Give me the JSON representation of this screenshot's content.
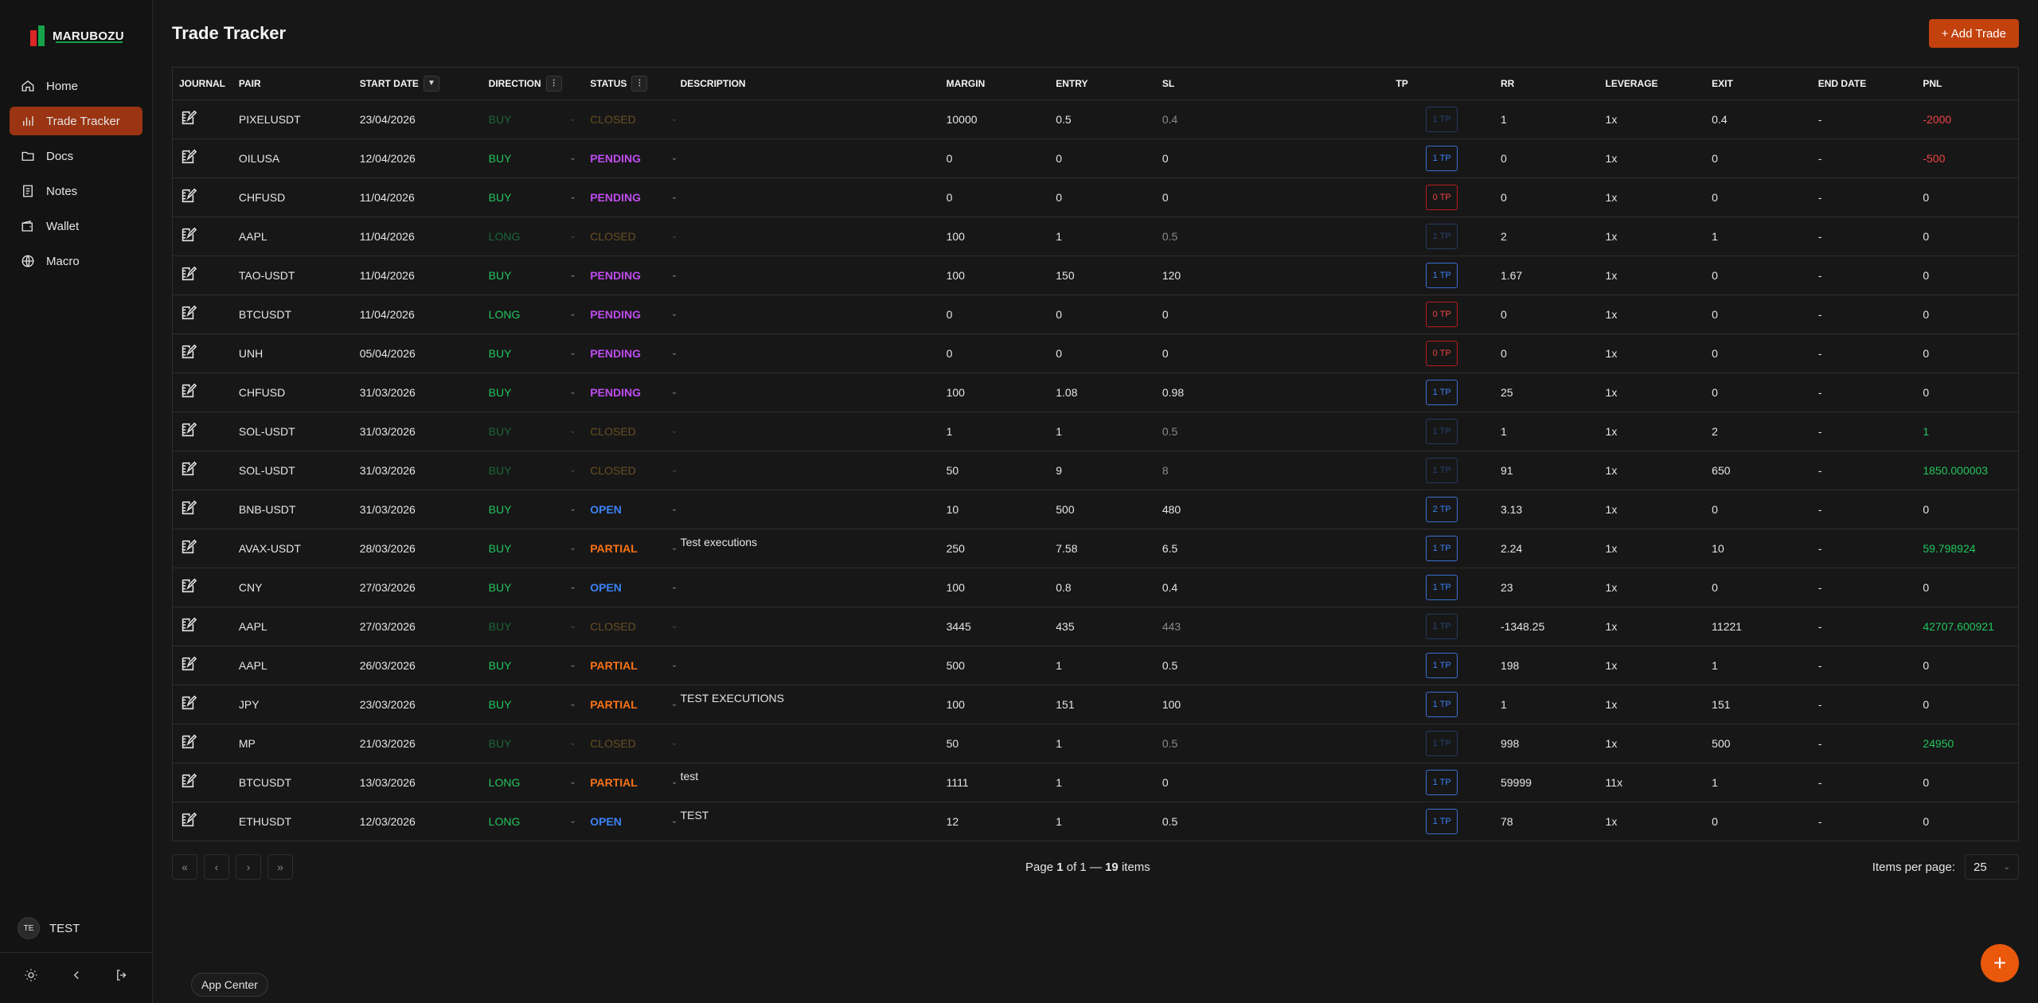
{
  "brand": {
    "name": "MARUBOZU"
  },
  "nav": [
    {
      "label": "Home",
      "icon": "home-icon",
      "active": false
    },
    {
      "label": "Trade Tracker",
      "icon": "chart-icon",
      "active": true
    },
    {
      "label": "Docs",
      "icon": "folder-icon",
      "active": false
    },
    {
      "label": "Notes",
      "icon": "notes-icon",
      "active": false
    },
    {
      "label": "Wallet",
      "icon": "wallet-icon",
      "active": false
    },
    {
      "label": "Macro",
      "icon": "globe-icon",
      "active": false
    }
  ],
  "user": {
    "initials": "TE",
    "name": "TEST"
  },
  "page": {
    "title": "Trade Tracker",
    "add_button": "+ Add Trade"
  },
  "columns": {
    "journal": "JOURNAL",
    "pair": "PAIR",
    "start_date": "START DATE",
    "direction": "DIRECTION",
    "status": "STATUS",
    "description": "DESCRIPTION",
    "margin": "MARGIN",
    "entry": "ENTRY",
    "sl": "SL",
    "tp": "TP",
    "rr": "RR",
    "leverage": "LEVERAGE",
    "exit": "EXIT",
    "end_date": "END DATE",
    "pnl": "PNL"
  },
  "rows": [
    {
      "pair": "PIXELUSDT",
      "date": "23/04/2026",
      "dir": "BUY",
      "status": "CLOSED",
      "desc": "",
      "margin": "10000",
      "entry": "0.5",
      "sl": "0.4",
      "tp": "1 TP",
      "rr": "1",
      "lev": "1x",
      "exit": "0.4",
      "end": "-",
      "pnl": "-2000",
      "pnl_class": "neg"
    },
    {
      "pair": "OILUSA",
      "date": "12/04/2026",
      "dir": "BUY",
      "status": "PENDING",
      "desc": "",
      "margin": "0",
      "entry": "0",
      "sl": "0",
      "tp": "1 TP",
      "rr": "0",
      "lev": "1x",
      "exit": "0",
      "end": "-",
      "pnl": "-500",
      "pnl_class": "neg"
    },
    {
      "pair": "CHFUSD",
      "date": "11/04/2026",
      "dir": "BUY",
      "status": "PENDING",
      "desc": "",
      "margin": "0",
      "entry": "0",
      "sl": "0",
      "tp": "0 TP",
      "rr": "0",
      "lev": "1x",
      "exit": "0",
      "end": "-",
      "pnl": "0",
      "pnl_class": ""
    },
    {
      "pair": "AAPL",
      "date": "11/04/2026",
      "dir": "LONG",
      "status": "CLOSED",
      "desc": "",
      "margin": "100",
      "entry": "1",
      "sl": "0.5",
      "tp": "1 TP",
      "rr": "2",
      "lev": "1x",
      "exit": "1",
      "end": "-",
      "pnl": "0",
      "pnl_class": ""
    },
    {
      "pair": "TAO-USDT",
      "date": "11/04/2026",
      "dir": "BUY",
      "status": "PENDING",
      "desc": "",
      "margin": "100",
      "entry": "150",
      "sl": "120",
      "tp": "1 TP",
      "rr": "1.67",
      "lev": "1x",
      "exit": "0",
      "end": "-",
      "pnl": "0",
      "pnl_class": ""
    },
    {
      "pair": "BTCUSDT",
      "date": "11/04/2026",
      "dir": "LONG",
      "status": "PENDING",
      "desc": "",
      "margin": "0",
      "entry": "0",
      "sl": "0",
      "tp": "0 TP",
      "rr": "0",
      "lev": "1x",
      "exit": "0",
      "end": "-",
      "pnl": "0",
      "pnl_class": ""
    },
    {
      "pair": "UNH",
      "date": "05/04/2026",
      "dir": "BUY",
      "status": "PENDING",
      "desc": "",
      "margin": "0",
      "entry": "0",
      "sl": "0",
      "tp": "0 TP",
      "rr": "0",
      "lev": "1x",
      "exit": "0",
      "end": "-",
      "pnl": "0",
      "pnl_class": ""
    },
    {
      "pair": "CHFUSD",
      "date": "31/03/2026",
      "dir": "BUY",
      "status": "PENDING",
      "desc": "",
      "margin": "100",
      "entry": "1.08",
      "sl": "0.98",
      "tp": "1 TP",
      "rr": "25",
      "lev": "1x",
      "exit": "0",
      "end": "-",
      "pnl": "0",
      "pnl_class": ""
    },
    {
      "pair": "SOL-USDT",
      "date": "31/03/2026",
      "dir": "BUY",
      "status": "CLOSED",
      "desc": "",
      "margin": "1",
      "entry": "1",
      "sl": "0.5",
      "tp": "1 TP",
      "rr": "1",
      "lev": "1x",
      "exit": "2",
      "end": "-",
      "pnl": "1",
      "pnl_class": "pos"
    },
    {
      "pair": "SOL-USDT",
      "date": "31/03/2026",
      "dir": "BUY",
      "status": "CLOSED",
      "desc": "",
      "margin": "50",
      "entry": "9",
      "sl": "8",
      "tp": "1 TP",
      "rr": "91",
      "lev": "1x",
      "exit": "650",
      "end": "-",
      "pnl": "1850.000003",
      "pnl_class": "pos"
    },
    {
      "pair": "BNB-USDT",
      "date": "31/03/2026",
      "dir": "BUY",
      "status": "OPEN",
      "desc": "",
      "margin": "10",
      "entry": "500",
      "sl": "480",
      "tp": "2 TP",
      "rr": "3.13",
      "lev": "1x",
      "exit": "0",
      "end": "-",
      "pnl": "0",
      "pnl_class": ""
    },
    {
      "pair": "AVAX-USDT",
      "date": "28/03/2026",
      "dir": "BUY",
      "status": "PARTIAL",
      "desc": "Test executions",
      "margin": "250",
      "entry": "7.58",
      "sl": "6.5",
      "tp": "1 TP",
      "rr": "2.24",
      "lev": "1x",
      "exit": "10",
      "end": "-",
      "pnl": "59.798924",
      "pnl_class": "pos"
    },
    {
      "pair": "CNY",
      "date": "27/03/2026",
      "dir": "BUY",
      "status": "OPEN",
      "desc": "",
      "margin": "100",
      "entry": "0.8",
      "sl": "0.4",
      "tp": "1 TP",
      "rr": "23",
      "lev": "1x",
      "exit": "0",
      "end": "-",
      "pnl": "0",
      "pnl_class": ""
    },
    {
      "pair": "AAPL",
      "date": "27/03/2026",
      "dir": "BUY",
      "status": "CLOSED",
      "desc": "",
      "margin": "3445",
      "entry": "435",
      "sl": "443",
      "tp": "1 TP",
      "rr": "-1348.25",
      "lev": "1x",
      "exit": "11221",
      "end": "-",
      "pnl": "42707.600921",
      "pnl_class": "pos"
    },
    {
      "pair": "AAPL",
      "date": "26/03/2026",
      "dir": "BUY",
      "status": "PARTIAL",
      "desc": "",
      "margin": "500",
      "entry": "1",
      "sl": "0.5",
      "tp": "1 TP",
      "rr": "198",
      "lev": "1x",
      "exit": "1",
      "end": "-",
      "pnl": "0",
      "pnl_class": ""
    },
    {
      "pair": "JPY",
      "date": "23/03/2026",
      "dir": "BUY",
      "status": "PARTIAL",
      "desc": "TEST EXECUTIONS",
      "margin": "100",
      "entry": "151",
      "sl": "100",
      "tp": "1 TP",
      "rr": "1",
      "lev": "1x",
      "exit": "151",
      "end": "-",
      "pnl": "0",
      "pnl_class": ""
    },
    {
      "pair": "MP",
      "date": "21/03/2026",
      "dir": "BUY",
      "status": "CLOSED",
      "desc": "",
      "margin": "50",
      "entry": "1",
      "sl": "0.5",
      "tp": "1 TP",
      "rr": "998",
      "lev": "1x",
      "exit": "500",
      "end": "-",
      "pnl": "24950",
      "pnl_class": "pos"
    },
    {
      "pair": "BTCUSDT",
      "date": "13/03/2026",
      "dir": "LONG",
      "status": "PARTIAL",
      "desc": "test",
      "margin": "1111",
      "entry": "1",
      "sl": "0",
      "tp": "1 TP",
      "rr": "59999",
      "lev": "11x",
      "exit": "1",
      "end": "-",
      "pnl": "0",
      "pnl_class": ""
    },
    {
      "pair": "ETHUSDT",
      "date": "12/03/2026",
      "dir": "LONG",
      "status": "OPEN",
      "desc": "TEST",
      "margin": "12",
      "entry": "1",
      "sl": "0.5",
      "tp": "1 TP",
      "rr": "78",
      "lev": "1x",
      "exit": "0",
      "end": "-",
      "pnl": "0",
      "pnl_class": ""
    }
  ],
  "pagination": {
    "page_prefix": "Page",
    "page": "1",
    "of_total": "of 1 —",
    "items": "19",
    "items_suffix": "items",
    "per_page_label": "Items per page:",
    "per_page_value": "25"
  },
  "footer": {
    "app_center": "App Center"
  },
  "colors": {
    "accent": "#c2410c",
    "buy": "#22c55e",
    "pending": "#c04cf0",
    "closed": "#c99434",
    "open": "#3b82f6",
    "partial": "#f97316",
    "negative": "#ef4444"
  }
}
